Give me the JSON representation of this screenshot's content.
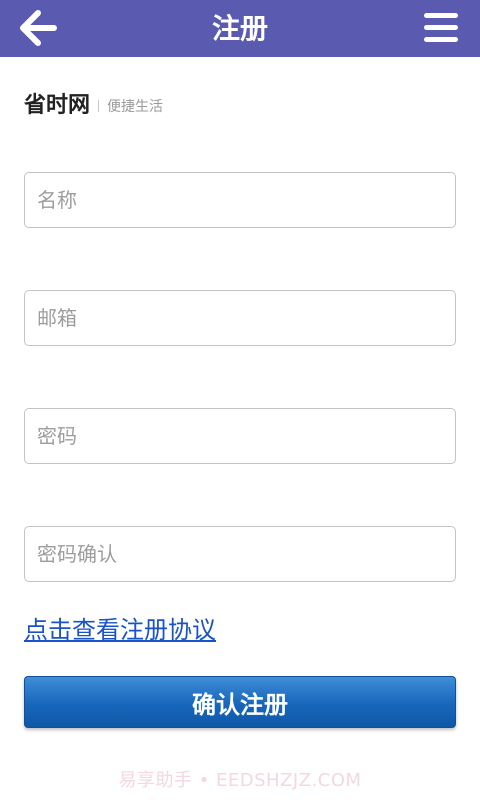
{
  "header": {
    "title": "注册",
    "back_icon": "back-arrow-icon",
    "menu_icon": "hamburger-menu-icon",
    "bg_color": "#5a5ab1"
  },
  "brand": {
    "name": "省时网",
    "slogan": "便捷生活"
  },
  "form": {
    "name_placeholder": "名称",
    "email_placeholder": "邮箱",
    "password_placeholder": "密码",
    "confirm_placeholder": "密码确认"
  },
  "agreement_link": "点击查看注册协议",
  "submit_label": "确认注册",
  "watermark": "易享助手 • EEDSHZJZ.COM",
  "colors": {
    "link": "#1a53c8",
    "button": "#1766bb"
  }
}
